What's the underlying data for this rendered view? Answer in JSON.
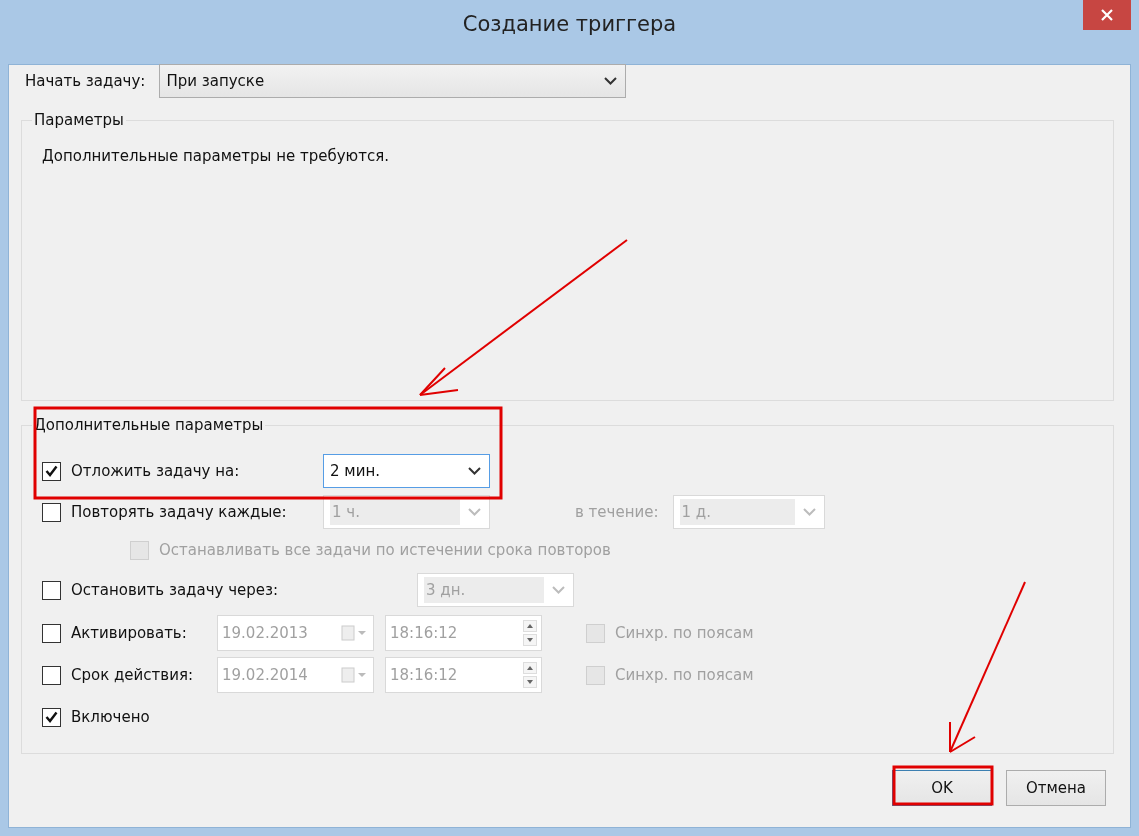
{
  "window": {
    "title": "Создание триггера"
  },
  "start": {
    "label": "Начать задачу:",
    "value": "При запуске"
  },
  "parameters": {
    "title": "Параметры",
    "text": "Дополнительные параметры не требуются."
  },
  "advanced": {
    "title": "Дополнительные параметры",
    "rows": [
      {
        "kind": "dropdown",
        "label": "Отложить задачу на:",
        "checked": true,
        "value": "2 мин.",
        "disabled": false,
        "focused": true
      },
      {
        "kind": "repeat",
        "label": "Повторять задачу каждые:",
        "checked": false,
        "value": "1 ч.",
        "disabled": true,
        "duration_label": "в течение:",
        "duration_value": "1 д."
      },
      {
        "kind": "subcheck",
        "label": "Останавливать все задачи по истечении срока повторов",
        "checked": false,
        "disabled": true
      },
      {
        "kind": "dropdown",
        "label": "Остановить задачу через:",
        "checked": false,
        "value": "3 дн.",
        "disabled": true,
        "focused": false
      },
      {
        "kind": "datetime",
        "label": "Активировать:",
        "checked": false,
        "date": "19.02.2013",
        "time": "18:16:12",
        "sync_label": "Синхр. по поясам",
        "sync_checked": false,
        "disabled": true
      },
      {
        "kind": "datetime",
        "label": "Срок действия:",
        "checked": false,
        "date": "19.02.2014",
        "time": "18:16:12",
        "sync_label": "Синхр. по поясам",
        "sync_checked": false,
        "disabled": true
      },
      {
        "kind": "check",
        "label": "Включено",
        "checked": true,
        "disabled": false
      }
    ]
  },
  "buttons": [
    {
      "label": "OK",
      "kind": "default"
    },
    {
      "label": "Отмена",
      "kind": "normal"
    }
  ]
}
